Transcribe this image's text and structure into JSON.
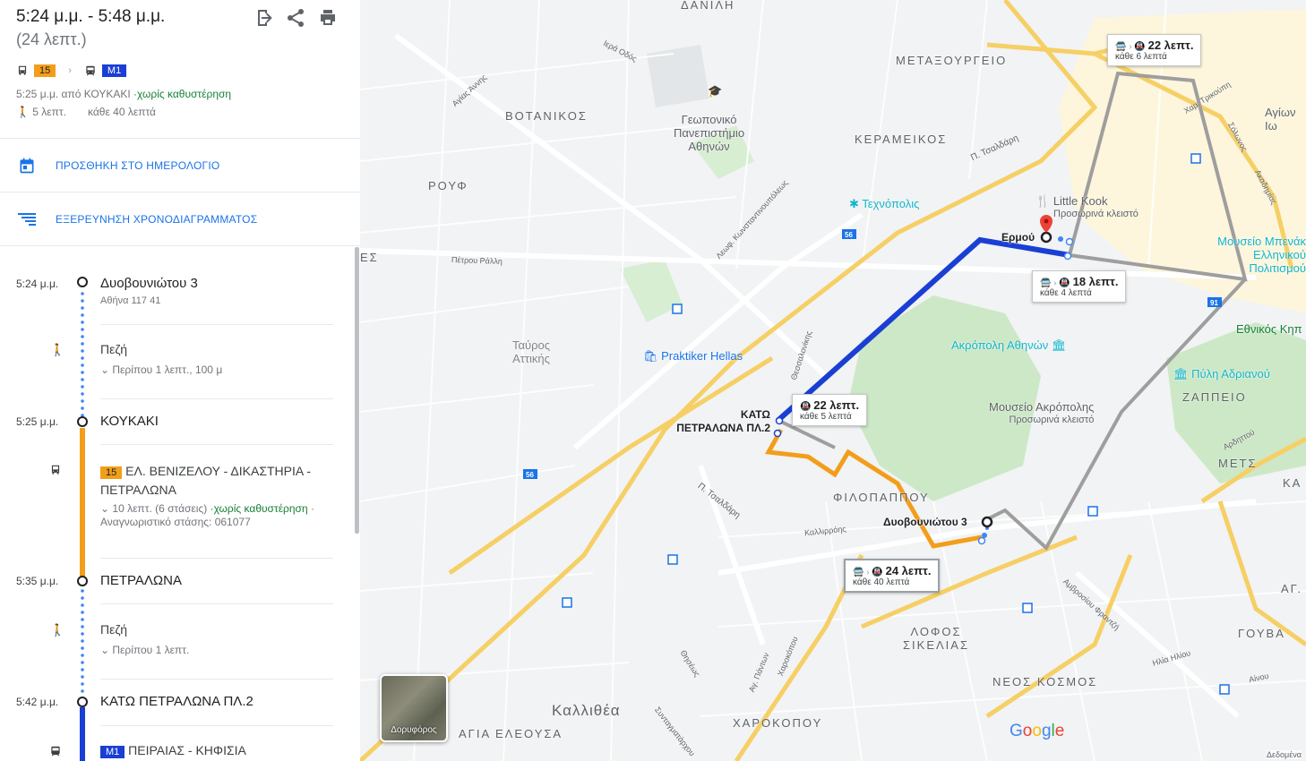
{
  "header": {
    "time_range": "5:24 μ.μ. - 5:48 μ.μ.",
    "duration": "(24 λεπτ.)",
    "mode_badge_1": "15",
    "mode_badge_2": "M1",
    "departure": "5:25 μ.μ. από ΚΟΥΚΑΚΙ",
    "departure_status": "·χωρίς καθυστέρηση",
    "walk": "5 λεπτ.",
    "frequency": "κάθε 40 λεπτά",
    "icons": [
      "send-to-phone-icon",
      "share-icon",
      "print-icon"
    ]
  },
  "actions": {
    "calendar": "ΠΡΟΣΘΗΚΗ ΣΤΟ ΗΜΕΡΟΛΟΓΙΟ",
    "schedule": "ΕΞΕΡΕΥΝΗΣΗ ΧΡΟΝΟΔΙΑΓΡΑΜΜΑΤΟΣ"
  },
  "timeline": {
    "s1_time": "5:24 μ.μ.",
    "s1_name": "Δυοβουνιώτου 3",
    "s1_sub": "Αθήνα 117 41",
    "walk1_mode": "Πεζή",
    "walk1_det": "Περίπου 1 λεπτ., 100 μ",
    "s2_time": "5:25 μ.μ.",
    "s2_name": "ΚΟΥΚΑΚΙ",
    "bus_badge": "15",
    "bus_line": "ΕΛ. ΒΕΝΙΖΕΛΟΥ - ΔΙΚΑΣΤΗΡΙΑ - ΠΕΤΡΑΛΩΝΑ",
    "bus_det1": "10 λεπτ. (6 στάσεις)",
    "bus_det_ok": "·χωρίς καθυστέρηση",
    "bus_det2": "· Αναγνωριστικό στάσης: 061077",
    "s3_time": "5:35 μ.μ.",
    "s3_name": "ΠΕΤΡΑΛΩΝΑ",
    "walk2_mode": "Πεζή",
    "walk2_det": "Περίπου 1 λεπτ.",
    "s4_time": "5:42 μ.μ.",
    "s4_name": "ΚΑΤΩ ΠΕΤΡΑΛΩΝΑ ΠΛ.2",
    "metro_badge": "M1",
    "metro_line": "ΠΕΙΡΑΙΑΣ - ΚΗΦΙΣΙΑ"
  },
  "map": {
    "callouts": [
      {
        "title": "22 λεπτ.",
        "sub": "κάθε 6 λεπτά"
      },
      {
        "title": "18 λεπτ.",
        "sub": "κάθε 4 λεπτά"
      },
      {
        "title": "22 λεπτ.",
        "sub": "κάθε 5 λεπτά"
      },
      {
        "title": "24 λεπτ.",
        "sub": "κάθε 40 λεπτά"
      }
    ],
    "places": {
      "origin": "Δυοβουνιώτου 3",
      "destination": "Ερμού",
      "kato_line1": "ΚΑΤΩ",
      "kato_line2": "ΠΕΤΡΑΛΩΝΑ ΠΛ.2"
    },
    "labels": {
      "danili": "ΔΑΝΙΛΗ",
      "metaxourgeio": "ΜΕΤΑΞΟΥΡΓΕΙΟ",
      "votanikos": "ΒΟΤΑΝΙΚΟΣ",
      "kerameikos": "ΚΕΡΑΜΕΙΚΟΣ",
      "rouf": "ΡΟΥΦ",
      "filopappou": "ΦΙΛΟΠΑΠΠΟΥ",
      "lofos_1": "ΛΟΦΟΣ",
      "lofos_2": "ΣΙΚΕΛΙΑΣ",
      "neos_kosmos": "ΝΕΟΣ ΚΟΣΜΟΣ",
      "charokopou": "ΧΑΡΟΚΟΠΟΥ",
      "agia_eleousa": "ΑΓΙΑ ΕΛΕΟΥΣΑ",
      "zappeio": "ΖΑΠΠΕΙΟ",
      "mets": "ΜΕΤΣ",
      "gouva": "ΓΟΥΒΑ",
      "kallithea": "Καλλιθέα",
      "ag": "ΑΓ.",
      "ka": "ΚΑ",
      "es": "ΕΣ"
    },
    "pois": {
      "geoponiko_1": "Γεωπονικό",
      "geoponiko_2": "Πανεπιστήμιο",
      "geoponiko_3": "Αθηνών",
      "technopolis": "Τεχνόπολις",
      "little_kook": "Little Kook",
      "little_kook_sub": "Προσωρινά κλειστό",
      "benaki_1": "Μουσείο Μπενάκ",
      "benaki_2": "Ελληνικού Πολιτισμού",
      "acropolis": "Ακρόπολη Αθηνών",
      "acropolis_museum": "Μουσείο Ακρόπολης",
      "acropolis_museum_sub": "Προσωρινά κλειστό",
      "hadrian": "Πύλη Αδριανού",
      "national_garden": "Εθνικός Κηπ",
      "praktiker": "Praktiker Hellas",
      "tavros_1": "Ταύρος",
      "tavros_2": "Αττικής",
      "agion": "Αγίων Ιω"
    },
    "streets": {
      "iera_odos": "Ιερά Οδός",
      "agias_annis": "Αγίας Άννης",
      "tsaldari_1": "Π. Τσαλδάρη",
      "tsaldari_2": "Π. Τσαλδάρη",
      "petrou_ralli": "Πέτρου Ράλλη",
      "konstantinoupoleos": "Λεωφ. Κωνσταντινουπόλεως",
      "thessalonikis": "Θεσσαλονίκης",
      "kallirrois": "Καλλιρρόης",
      "charokopou": "Χαροκόπου",
      "ag_pantwn": "Αγ. Πάντων",
      "theseos": "Θησέως",
      "syntagmatarchou": "Συνταγματάρχου",
      "ampr_frantzi": "Αμβροσίου Φραντζή",
      "ilia_iliou": "Ηλία Ηλίου",
      "ardittou": "Αρδηττού",
      "trikoupi": "Χαρ. Τρικούπη",
      "solonos": "Σόλωνος",
      "akadimias": "Ακαδημίας",
      "ainou": "Αίνου"
    },
    "shields": [
      "56",
      "56",
      "91"
    ],
    "satellite": "Δορυφόρος",
    "data_credit": "Δεδομένα",
    "logo": [
      "G",
      "o",
      "o",
      "g",
      "l",
      "e"
    ],
    "colors": {
      "bus": "#f29e1b",
      "metro": "#1a3fd4",
      "walk": "#4285f4",
      "alt": "#9e9e9e",
      "road": "#f6cf65"
    }
  }
}
